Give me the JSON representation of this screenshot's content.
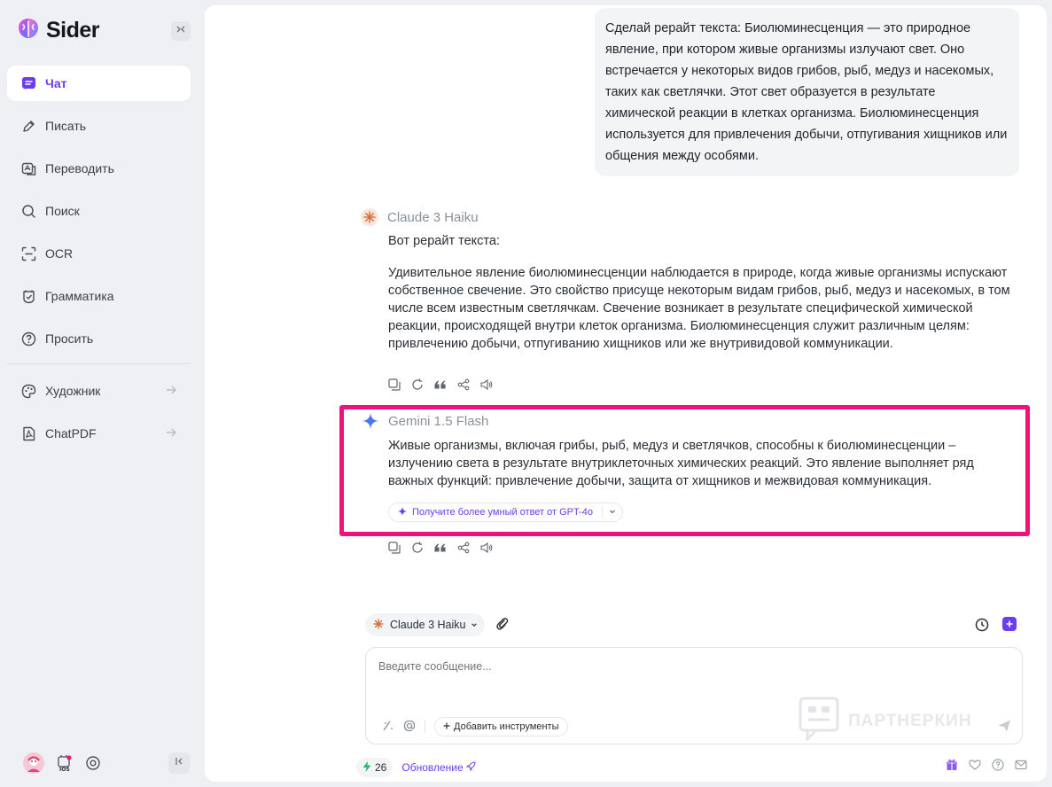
{
  "app": {
    "name": "Sider"
  },
  "sidebar": {
    "items": [
      {
        "label": "Чат",
        "icon": "chat-icon",
        "active": true
      },
      {
        "label": "Писать",
        "icon": "pen-icon"
      },
      {
        "label": "Переводить",
        "icon": "translate-icon"
      },
      {
        "label": "Поиск",
        "icon": "search-icon"
      },
      {
        "label": "OCR",
        "icon": "scan-icon"
      },
      {
        "label": "Грамматика",
        "icon": "grammar-icon"
      },
      {
        "label": "Просить",
        "icon": "question-icon"
      }
    ],
    "tools": [
      {
        "label": "Художник",
        "icon": "palette-icon"
      },
      {
        "label": "ChatPDF",
        "icon": "pdf-icon"
      }
    ]
  },
  "chat": {
    "user_message": "Сделай рерайт текста:   Биолюминесценция — это природное явление, при котором живые организмы излучают свет. Оно встречается у некоторых видов грибов, рыб, медуз и насекомых, таких как светлячки. Этот свет образуется в результате химической реакции в клетках организма. Биолюминесценция используется для привлечения добычи, отпугивания хищников или общения между особями.",
    "responses": [
      {
        "model": "Claude 3 Haiku",
        "intro": "Вот рерайт текста:",
        "text": "Удивительное явление биолюминесценции наблюдается в природе, когда живые организмы испускают собственное свечение. Это свойство присуще некоторым видам грибов, рыб, медуз и насекомых, в том числе всем известным светлячкам. Свечение возникает в результате специфической химической реакции, происходящей внутри клеток организма. Биолюминесценция служит различным целям: привлечению добычи, отпугиванию хищников или же внутривидовой коммуникации."
      },
      {
        "model": "Gemini 1.5 Flash",
        "text": "Живые организмы, включая грибы, рыб, медуз и светлячков, способны к биолюминесценции – излучению света в результате внутриклеточных химических реакций. Это явление выполняет ряд важных функций: привлечение добычи, защита от хищников и межвидовая коммуникация.",
        "upgrade_label": "Получите более умный ответ от GPT-4o"
      }
    ]
  },
  "composer": {
    "model": "Claude 3 Haiku",
    "placeholder": "Введите сообщение...",
    "add_tools": "Добавить инструменты"
  },
  "footer": {
    "credits": "26",
    "update": "Обновление"
  },
  "watermark": "ПАРТНЕРКИН",
  "colors": {
    "accent": "#6b3df2",
    "highlight": "#f0127b"
  }
}
